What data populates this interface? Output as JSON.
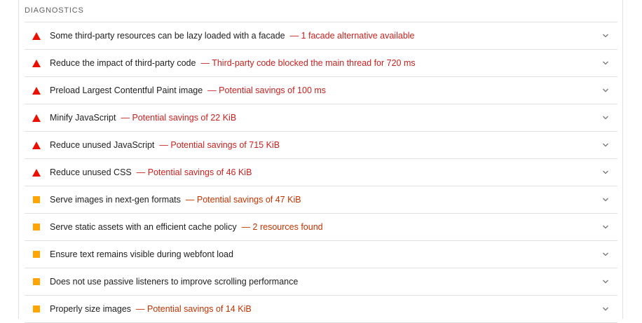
{
  "section": {
    "title": "DIAGNOSTICS"
  },
  "colors": {
    "fail": "#eb0f00",
    "fail_text": "#c7221f",
    "average": "#ffa400",
    "average_text": "#c33300",
    "divider": "#e0e0e0"
  },
  "audits": [
    {
      "status": "fail",
      "icon": "red-triangle-icon",
      "title": "Some third-party resources can be lazy loaded with a facade",
      "display": "— 1 facade alternative available"
    },
    {
      "status": "fail",
      "icon": "red-triangle-icon",
      "title": "Reduce the impact of third-party code",
      "display": "— Third-party code blocked the main thread for 720 ms"
    },
    {
      "status": "fail",
      "icon": "red-triangle-icon",
      "title": "Preload Largest Contentful Paint image",
      "display": "— Potential savings of 100 ms"
    },
    {
      "status": "fail",
      "icon": "red-triangle-icon",
      "title": "Minify JavaScript",
      "display": "— Potential savings of 22 KiB"
    },
    {
      "status": "fail",
      "icon": "red-triangle-icon",
      "title": "Reduce unused JavaScript",
      "display": "— Potential savings of 715 KiB"
    },
    {
      "status": "fail",
      "icon": "red-triangle-icon",
      "title": "Reduce unused CSS",
      "display": "— Potential savings of 46 KiB"
    },
    {
      "status": "average",
      "icon": "orange-square-icon",
      "title": "Serve images in next-gen formats",
      "display": "— Potential savings of 47 KiB"
    },
    {
      "status": "average",
      "icon": "orange-square-icon",
      "title": "Serve static assets with an efficient cache policy",
      "display": "— 2 resources found"
    },
    {
      "status": "average",
      "icon": "orange-square-icon",
      "title": "Ensure text remains visible during webfont load",
      "display": ""
    },
    {
      "status": "average",
      "icon": "orange-square-icon",
      "title": "Does not use passive listeners to improve scrolling performance",
      "display": ""
    },
    {
      "status": "average",
      "icon": "orange-square-icon",
      "title": "Properly size images",
      "display": "— Potential savings of 14 KiB"
    }
  ]
}
